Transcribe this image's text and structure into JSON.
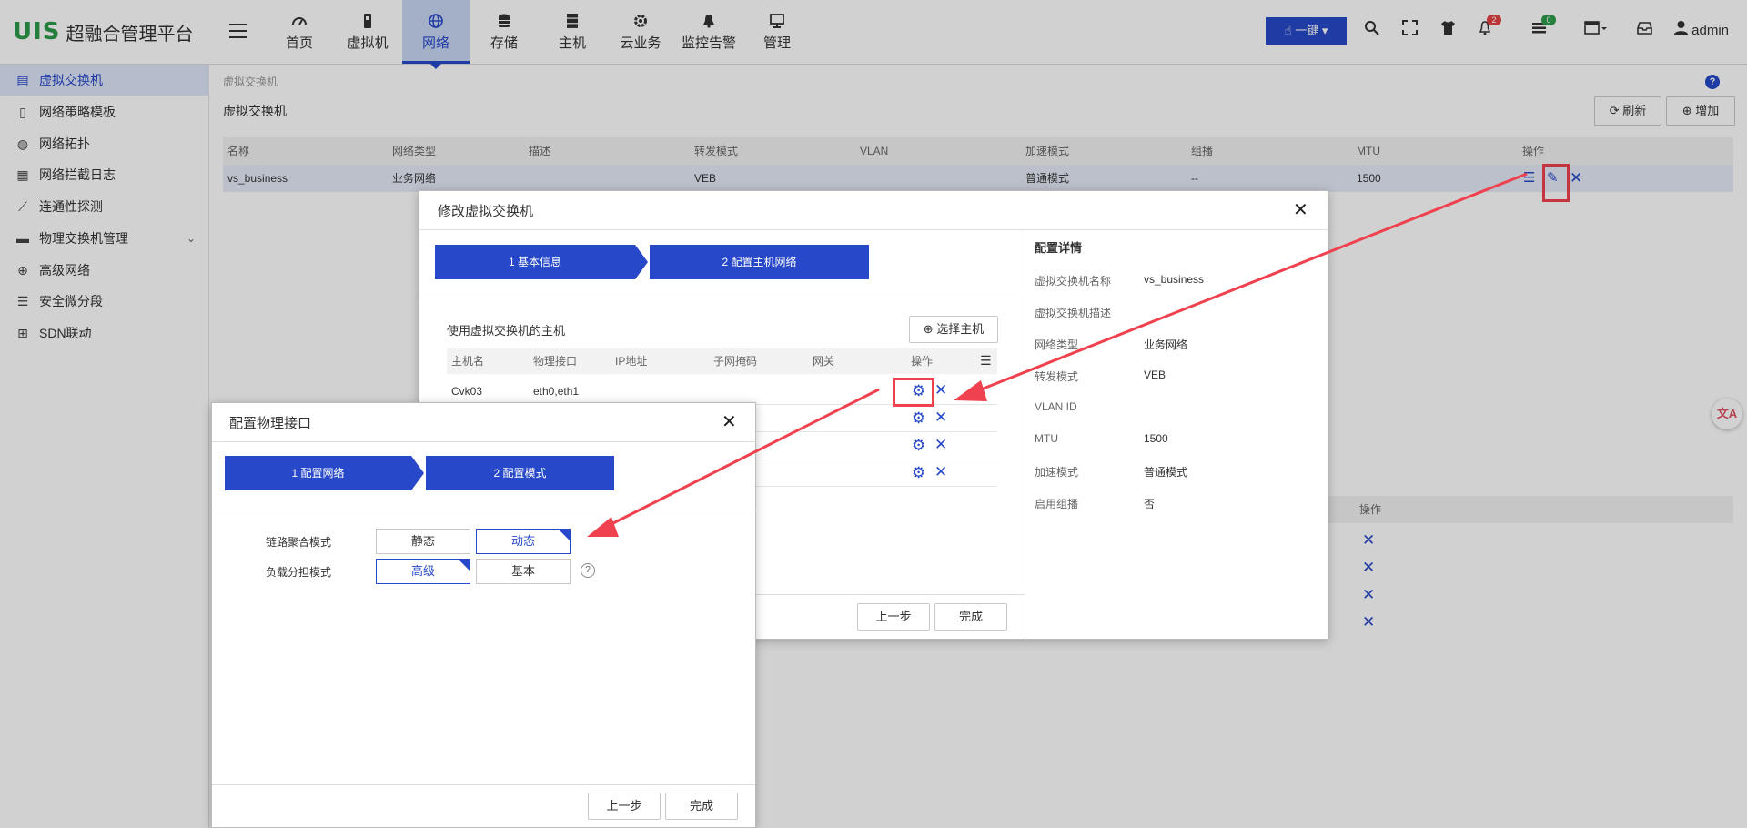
{
  "app": {
    "logo_mark": "UIS",
    "logo_name": "超融合管理平台"
  },
  "topnav": [
    {
      "label": "首页",
      "icon": "dashboard-icon"
    },
    {
      "label": "虚拟机",
      "icon": "vm-icon"
    },
    {
      "label": "网络",
      "icon": "globe-icon"
    },
    {
      "label": "存储",
      "icon": "database-icon"
    },
    {
      "label": "主机",
      "icon": "server-icon"
    },
    {
      "label": "云业务",
      "icon": "gear-icon"
    },
    {
      "label": "监控告警",
      "icon": "bell-icon"
    },
    {
      "label": "管理",
      "icon": "monitor-icon"
    }
  ],
  "topright": {
    "onekey_label": "一键",
    "alarm_count": "2",
    "task_count": "0",
    "user": "admin"
  },
  "sidebar": [
    {
      "label": "虚拟交换机"
    },
    {
      "label": "网络策略模板"
    },
    {
      "label": "网络拓扑"
    },
    {
      "label": "网络拦截日志"
    },
    {
      "label": "连通性探测"
    },
    {
      "label": "物理交换机管理"
    },
    {
      "label": "高级网络"
    },
    {
      "label": "安全微分段"
    },
    {
      "label": "SDN联动"
    }
  ],
  "main": {
    "breadcrumb": "虚拟交换机",
    "title": "虚拟交换机",
    "refresh_label": "刷新",
    "add_label": "增加",
    "columns": [
      "名称",
      "网络类型",
      "描述",
      "转发模式",
      "VLAN",
      "加速模式",
      "组播",
      "MTU",
      "操作"
    ],
    "row": {
      "name": "vs_business",
      "type": "业务网络",
      "desc": "",
      "forward": "VEB",
      "vlan": "",
      "accel": "普通模式",
      "multicast": "--",
      "mtu": "1500"
    },
    "bg_op_header": "操作"
  },
  "edit_dialog": {
    "title": "修改虚拟交换机",
    "step1": "1 基本信息",
    "step2": "2 配置主机网络",
    "hosts_title": "使用虚拟交换机的主机",
    "select_host_label": "选择主机",
    "host_columns": [
      "主机名",
      "物理接口",
      "IP地址",
      "子网掩码",
      "网关",
      "操作"
    ],
    "host_rows": [
      {
        "name": "Cvk03",
        "iface": "eth0,eth1"
      }
    ],
    "prev_label": "上一步",
    "finish_label": "完成",
    "details_title": "配置详情",
    "details": [
      {
        "label": "虚拟交换机名称",
        "value": "vs_business"
      },
      {
        "label": "虚拟交换机描述",
        "value": ""
      },
      {
        "label": "网络类型",
        "value": "业务网络"
      },
      {
        "label": "转发模式",
        "value": "VEB"
      },
      {
        "label": "VLAN ID",
        "value": ""
      },
      {
        "label": "MTU",
        "value": "1500"
      },
      {
        "label": "加速模式",
        "value": "普通模式"
      },
      {
        "label": "启用组播",
        "value": "否"
      }
    ]
  },
  "port_dialog": {
    "title": "配置物理接口",
    "step1": "1 配置网络",
    "step2": "2 配置模式",
    "lacp_label": "链路聚合模式",
    "lacp_options": [
      "静态",
      "动态"
    ],
    "lb_label": "负载分担模式",
    "lb_options": [
      "高级",
      "基本"
    ],
    "prev_label": "上一步",
    "finish_label": "完成"
  },
  "colors": {
    "brand": "#2748c8",
    "logo": "#2e9b4a",
    "arrow": "#f0414e"
  }
}
